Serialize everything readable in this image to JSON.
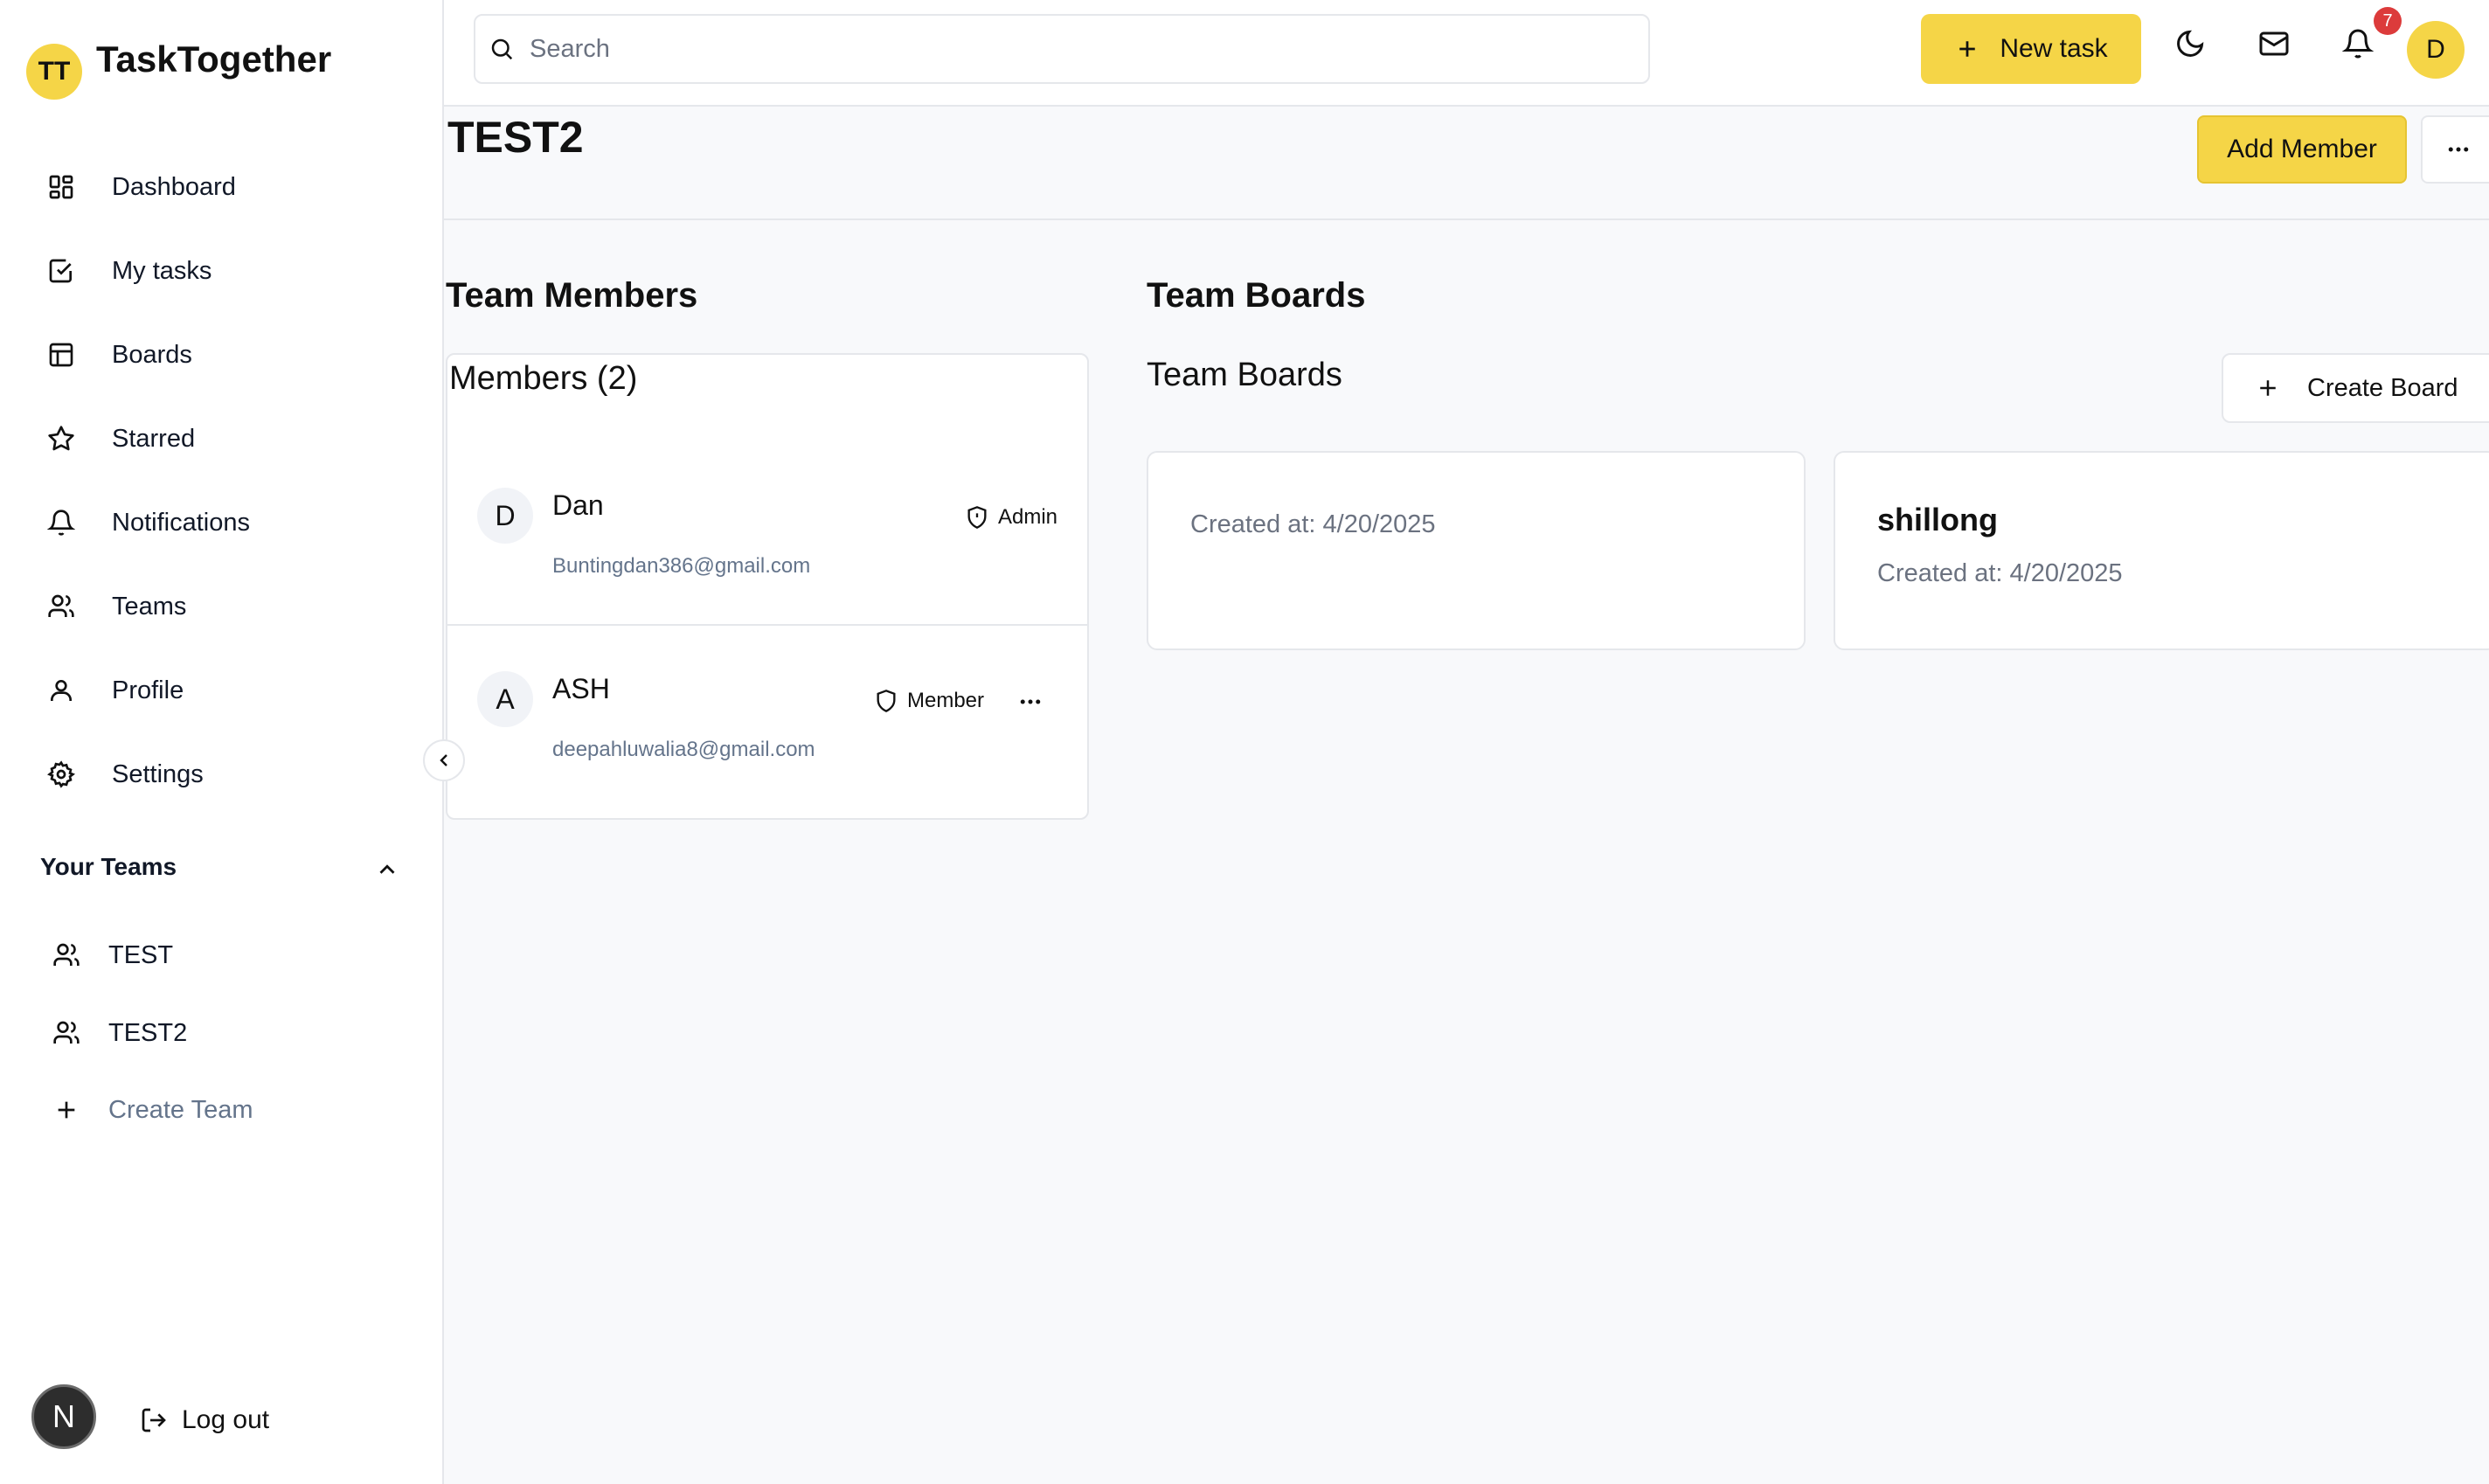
{
  "app": {
    "logo_initials": "TT",
    "title": "TaskTogether"
  },
  "sidebar": {
    "nav": [
      {
        "label": "Dashboard",
        "icon": "dashboard-icon"
      },
      {
        "label": "My tasks",
        "icon": "check-square-icon"
      },
      {
        "label": "Boards",
        "icon": "board-icon"
      },
      {
        "label": "Starred",
        "icon": "star-icon"
      },
      {
        "label": "Notifications",
        "icon": "bell-icon"
      },
      {
        "label": "Teams",
        "icon": "users-icon"
      },
      {
        "label": "Profile",
        "icon": "user-icon"
      },
      {
        "label": "Settings",
        "icon": "gear-icon"
      }
    ],
    "your_teams_title": "Your Teams",
    "teams": [
      {
        "label": "TEST"
      },
      {
        "label": "TEST2"
      }
    ],
    "create_team_label": "Create Team",
    "bottom_avatar_initial": "N",
    "logout_label": "Log out"
  },
  "topbar": {
    "search_placeholder": "Search",
    "new_task_label": "New task",
    "notification_count": "7",
    "user_initial": "D"
  },
  "page": {
    "title": "TEST2",
    "add_member_label": "Add Member"
  },
  "members_section": {
    "heading": "Team Members",
    "card_title": "Members (2)",
    "members": [
      {
        "initial": "D",
        "name": "Dan",
        "email": "Buntingdan386@gmail.com",
        "role": "Admin"
      },
      {
        "initial": "A",
        "name": "ASH",
        "email": "deepahluwalia8@gmail.com",
        "role": "Member"
      }
    ]
  },
  "boards_section": {
    "heading": "Team Boards",
    "subheading": "Team Boards",
    "create_board_label": "Create Board",
    "boards": [
      {
        "name": "",
        "created": "Created at: 4/20/2025"
      },
      {
        "name": "shillong",
        "created": "Created at: 4/20/2025"
      }
    ]
  },
  "colors": {
    "accent": "#f5d547",
    "badge": "#dc3b3b",
    "muted_text": "#64748b",
    "border": "#e5e7eb",
    "background": "#f8f9fb"
  }
}
